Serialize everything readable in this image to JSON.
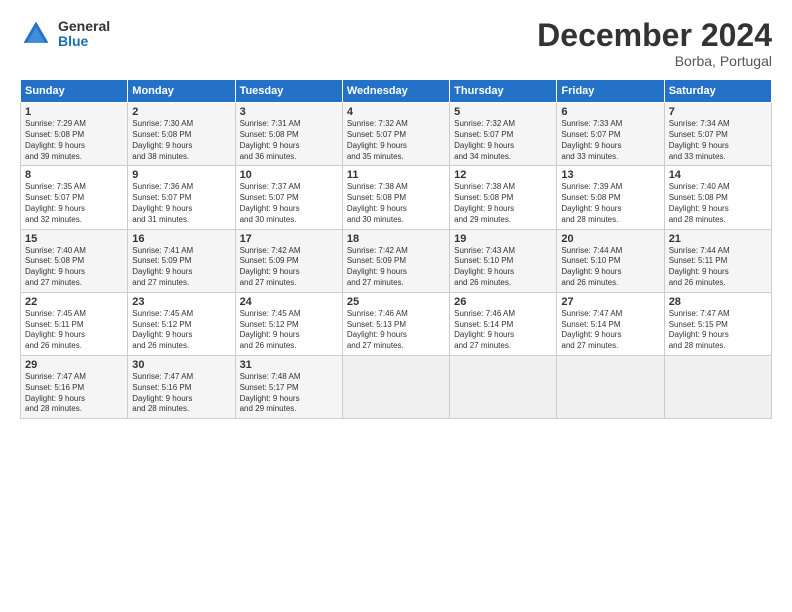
{
  "header": {
    "logo_general": "General",
    "logo_blue": "Blue",
    "month_title": "December 2024",
    "subtitle": "Borba, Portugal"
  },
  "weekdays": [
    "Sunday",
    "Monday",
    "Tuesday",
    "Wednesday",
    "Thursday",
    "Friday",
    "Saturday"
  ],
  "weeks": [
    [
      {
        "day": "1",
        "info": "Sunrise: 7:29 AM\nSunset: 5:08 PM\nDaylight: 9 hours\nand 39 minutes."
      },
      {
        "day": "2",
        "info": "Sunrise: 7:30 AM\nSunset: 5:08 PM\nDaylight: 9 hours\nand 38 minutes."
      },
      {
        "day": "3",
        "info": "Sunrise: 7:31 AM\nSunset: 5:08 PM\nDaylight: 9 hours\nand 36 minutes."
      },
      {
        "day": "4",
        "info": "Sunrise: 7:32 AM\nSunset: 5:07 PM\nDaylight: 9 hours\nand 35 minutes."
      },
      {
        "day": "5",
        "info": "Sunrise: 7:32 AM\nSunset: 5:07 PM\nDaylight: 9 hours\nand 34 minutes."
      },
      {
        "day": "6",
        "info": "Sunrise: 7:33 AM\nSunset: 5:07 PM\nDaylight: 9 hours\nand 33 minutes."
      },
      {
        "day": "7",
        "info": "Sunrise: 7:34 AM\nSunset: 5:07 PM\nDaylight: 9 hours\nand 33 minutes."
      }
    ],
    [
      {
        "day": "8",
        "info": "Sunrise: 7:35 AM\nSunset: 5:07 PM\nDaylight: 9 hours\nand 32 minutes."
      },
      {
        "day": "9",
        "info": "Sunrise: 7:36 AM\nSunset: 5:07 PM\nDaylight: 9 hours\nand 31 minutes."
      },
      {
        "day": "10",
        "info": "Sunrise: 7:37 AM\nSunset: 5:07 PM\nDaylight: 9 hours\nand 30 minutes."
      },
      {
        "day": "11",
        "info": "Sunrise: 7:38 AM\nSunset: 5:08 PM\nDaylight: 9 hours\nand 30 minutes."
      },
      {
        "day": "12",
        "info": "Sunrise: 7:38 AM\nSunset: 5:08 PM\nDaylight: 9 hours\nand 29 minutes."
      },
      {
        "day": "13",
        "info": "Sunrise: 7:39 AM\nSunset: 5:08 PM\nDaylight: 9 hours\nand 28 minutes."
      },
      {
        "day": "14",
        "info": "Sunrise: 7:40 AM\nSunset: 5:08 PM\nDaylight: 9 hours\nand 28 minutes."
      }
    ],
    [
      {
        "day": "15",
        "info": "Sunrise: 7:40 AM\nSunset: 5:08 PM\nDaylight: 9 hours\nand 27 minutes."
      },
      {
        "day": "16",
        "info": "Sunrise: 7:41 AM\nSunset: 5:09 PM\nDaylight: 9 hours\nand 27 minutes."
      },
      {
        "day": "17",
        "info": "Sunrise: 7:42 AM\nSunset: 5:09 PM\nDaylight: 9 hours\nand 27 minutes."
      },
      {
        "day": "18",
        "info": "Sunrise: 7:42 AM\nSunset: 5:09 PM\nDaylight: 9 hours\nand 27 minutes."
      },
      {
        "day": "19",
        "info": "Sunrise: 7:43 AM\nSunset: 5:10 PM\nDaylight: 9 hours\nand 26 minutes."
      },
      {
        "day": "20",
        "info": "Sunrise: 7:44 AM\nSunset: 5:10 PM\nDaylight: 9 hours\nand 26 minutes."
      },
      {
        "day": "21",
        "info": "Sunrise: 7:44 AM\nSunset: 5:11 PM\nDaylight: 9 hours\nand 26 minutes."
      }
    ],
    [
      {
        "day": "22",
        "info": "Sunrise: 7:45 AM\nSunset: 5:11 PM\nDaylight: 9 hours\nand 26 minutes."
      },
      {
        "day": "23",
        "info": "Sunrise: 7:45 AM\nSunset: 5:12 PM\nDaylight: 9 hours\nand 26 minutes."
      },
      {
        "day": "24",
        "info": "Sunrise: 7:45 AM\nSunset: 5:12 PM\nDaylight: 9 hours\nand 26 minutes."
      },
      {
        "day": "25",
        "info": "Sunrise: 7:46 AM\nSunset: 5:13 PM\nDaylight: 9 hours\nand 27 minutes."
      },
      {
        "day": "26",
        "info": "Sunrise: 7:46 AM\nSunset: 5:14 PM\nDaylight: 9 hours\nand 27 minutes."
      },
      {
        "day": "27",
        "info": "Sunrise: 7:47 AM\nSunset: 5:14 PM\nDaylight: 9 hours\nand 27 minutes."
      },
      {
        "day": "28",
        "info": "Sunrise: 7:47 AM\nSunset: 5:15 PM\nDaylight: 9 hours\nand 28 minutes."
      }
    ],
    [
      {
        "day": "29",
        "info": "Sunrise: 7:47 AM\nSunset: 5:16 PM\nDaylight: 9 hours\nand 28 minutes."
      },
      {
        "day": "30",
        "info": "Sunrise: 7:47 AM\nSunset: 5:16 PM\nDaylight: 9 hours\nand 28 minutes."
      },
      {
        "day": "31",
        "info": "Sunrise: 7:48 AM\nSunset: 5:17 PM\nDaylight: 9 hours\nand 29 minutes."
      },
      null,
      null,
      null,
      null
    ]
  ]
}
